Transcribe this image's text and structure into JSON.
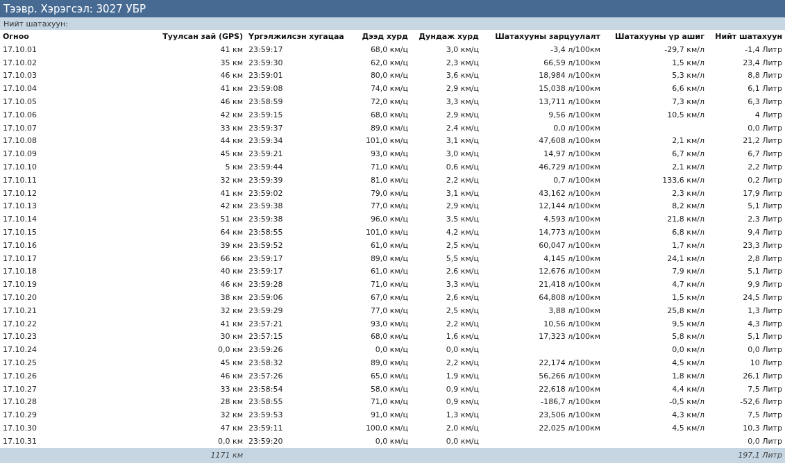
{
  "title": "Тээвр. Хэрэгсэл: 3027 УБР",
  "subtitle": "Нийт шатахуун:",
  "table": {
    "columns": [
      "Огноо",
      "Туулсан зай (GPS)",
      "Үргэлжилсэн хугацаа",
      "Дээд хурд",
      "Дундаж хурд",
      "Шатахууны зарцуулалт",
      "Шатахууны үр ашиг",
      "Нийт шатахуун"
    ],
    "rows": [
      [
        "17.10.01",
        "41 км",
        "23:59:17",
        "68,0 км/ц",
        "3,0 км/ц",
        "-3,4 л/100км",
        "-29,7 км/л",
        "-1,4 Литр"
      ],
      [
        "17.10.02",
        "35 км",
        "23:59:30",
        "62,0 км/ц",
        "2,3 км/ц",
        "66,59 л/100км",
        "1,5 км/л",
        "23,4 Литр"
      ],
      [
        "17.10.03",
        "46 км",
        "23:59:01",
        "80,0 км/ц",
        "3,6 км/ц",
        "18,984 л/100км",
        "5,3 км/л",
        "8,8 Литр"
      ],
      [
        "17.10.04",
        "41 км",
        "23:59:08",
        "74,0 км/ц",
        "2,9 км/ц",
        "15,038 л/100км",
        "6,6 км/л",
        "6,1 Литр"
      ],
      [
        "17.10.05",
        "46 км",
        "23:58:59",
        "72,0 км/ц",
        "3,3 км/ц",
        "13,711 л/100км",
        "7,3 км/л",
        "6,3 Литр"
      ],
      [
        "17.10.06",
        "42 км",
        "23:59:15",
        "68,0 км/ц",
        "2,9 км/ц",
        "9,56 л/100км",
        "10,5 км/л",
        "4 Литр"
      ],
      [
        "17.10.07",
        "33 км",
        "23:59:37",
        "89,0 км/ц",
        "2,4 км/ц",
        "0,0 л/100км",
        null,
        "0,0 Литр"
      ],
      [
        "17.10.08",
        "44 км",
        "23:59:34",
        "101,0 км/ц",
        "3,1 км/ц",
        "47,608 л/100км",
        "2,1 км/л",
        "21,2 Литр"
      ],
      [
        "17.10.09",
        "45 км",
        "23:59:21",
        "93,0 км/ц",
        "3,0 км/ц",
        "14,97 л/100км",
        "6,7 км/л",
        "6,7 Литр"
      ],
      [
        "17.10.10",
        "5 км",
        "23:59:44",
        "71,0 км/ц",
        "0,6 км/ц",
        "46,729 л/100км",
        "2,1 км/л",
        "2,2 Литр"
      ],
      [
        "17.10.11",
        "32 км",
        "23:59:39",
        "81,0 км/ц",
        "2,2 км/ц",
        "0,7 л/100км",
        "133,6 км/л",
        "0,2 Литр"
      ],
      [
        "17.10.12",
        "41 км",
        "23:59:02",
        "79,0 км/ц",
        "3,1 км/ц",
        "43,162 л/100км",
        "2,3 км/л",
        "17,9 Литр"
      ],
      [
        "17.10.13",
        "42 км",
        "23:59:38",
        "77,0 км/ц",
        "2,9 км/ц",
        "12,144 л/100км",
        "8,2 км/л",
        "5,1 Литр"
      ],
      [
        "17.10.14",
        "51 км",
        "23:59:38",
        "96,0 км/ц",
        "3,5 км/ц",
        "4,593 л/100км",
        "21,8 км/л",
        "2,3 Литр"
      ],
      [
        "17.10.15",
        "64 км",
        "23:58:55",
        "101,0 км/ц",
        "4,2 км/ц",
        "14,773 л/100км",
        "6,8 км/л",
        "9,4 Литр"
      ],
      [
        "17.10.16",
        "39 км",
        "23:59:52",
        "61,0 км/ц",
        "2,5 км/ц",
        "60,047 л/100км",
        "1,7 км/л",
        "23,3 Литр"
      ],
      [
        "17.10.17",
        "66 км",
        "23:59:17",
        "89,0 км/ц",
        "5,5 км/ц",
        "4,145 л/100км",
        "24,1 км/л",
        "2,8 Литр"
      ],
      [
        "17.10.18",
        "40 км",
        "23:59:17",
        "61,0 км/ц",
        "2,6 км/ц",
        "12,676 л/100км",
        "7,9 км/л",
        "5,1 Литр"
      ],
      [
        "17.10.19",
        "46 км",
        "23:59:28",
        "71,0 км/ц",
        "3,3 км/ц",
        "21,418 л/100км",
        "4,7 км/л",
        "9,9 Литр"
      ],
      [
        "17.10.20",
        "38 км",
        "23:59:06",
        "67,0 км/ц",
        "2,6 км/ц",
        "64,808 л/100км",
        "1,5 км/л",
        "24,5 Литр"
      ],
      [
        "17.10.21",
        "32 км",
        "23:59:29",
        "77,0 км/ц",
        "2,5 км/ц",
        "3,88 л/100км",
        "25,8 км/л",
        "1,3 Литр"
      ],
      [
        "17.10.22",
        "41 км",
        "23:57:21",
        "93,0 км/ц",
        "2,2 км/ц",
        "10,56 л/100км",
        "9,5 км/л",
        "4,3 Литр"
      ],
      [
        "17.10.23",
        "30 км",
        "23:57:15",
        "68,0 км/ц",
        "1,6 км/ц",
        "17,323 л/100км",
        "5,8 км/л",
        "5,1 Литр"
      ],
      [
        "17.10.24",
        "0,0 км",
        "23:59:26",
        "0,0 км/ц",
        "0,0 км/ц",
        null,
        "0,0 км/л",
        "0,0 Литр"
      ],
      [
        "17.10.25",
        "45 км",
        "23:58:32",
        "89,0 км/ц",
        "2,2 км/ц",
        "22,174 л/100км",
        "4,5 км/л",
        "10 Литр"
      ],
      [
        "17.10.26",
        "46 км",
        "23:57:26",
        "65,0 км/ц",
        "1,9 км/ц",
        "56,266 л/100км",
        "1,8 км/л",
        "26,1 Литр"
      ],
      [
        "17.10.27",
        "33 км",
        "23:58:54",
        "58,0 км/ц",
        "0,9 км/ц",
        "22,618 л/100км",
        "4,4 км/л",
        "7,5 Литр"
      ],
      [
        "17.10.28",
        "28 км",
        "23:58:55",
        "71,0 км/ц",
        "0,9 км/ц",
        "-186,7 л/100км",
        "-0,5 км/л",
        "-52,6 Литр"
      ],
      [
        "17.10.29",
        "32 км",
        "23:59:53",
        "91,0 км/ц",
        "1,3 км/ц",
        "23,506 л/100км",
        "4,3 км/л",
        "7,5 Литр"
      ],
      [
        "17.10.30",
        "47 км",
        "23:59:11",
        "100,0 км/ц",
        "2,0 км/ц",
        "22,025 л/100км",
        "4,5 км/л",
        "10,3 Литр"
      ],
      [
        "17.10.31",
        "0,0 км",
        "23:59:20",
        "0,0 км/ц",
        "0,0 км/ц",
        null,
        null,
        "0,0 Литр"
      ]
    ],
    "totals": {
      "distance": "1171 км",
      "fuel": "197,1 Литр"
    }
  }
}
